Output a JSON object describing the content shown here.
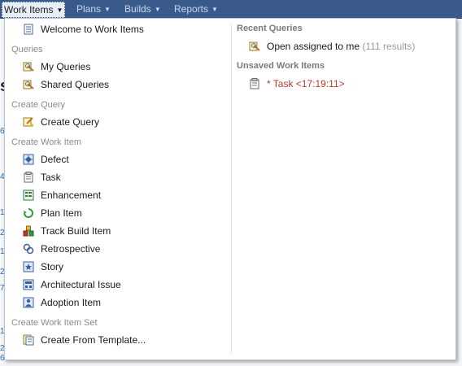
{
  "nav": {
    "items": [
      {
        "label": "Work Items"
      },
      {
        "label": "Plans"
      },
      {
        "label": "Builds"
      },
      {
        "label": "Reports"
      }
    ]
  },
  "menu": {
    "welcome": "Welcome to Work Items",
    "queries": {
      "header": "Queries",
      "my": "My Queries",
      "shared": "Shared Queries"
    },
    "create_query": {
      "header": "Create Query",
      "item": "Create Query"
    },
    "create_work_item": {
      "header": "Create Work Item",
      "items": [
        {
          "label": "Defect",
          "icon": "defect-icon"
        },
        {
          "label": "Task",
          "icon": "task-icon"
        },
        {
          "label": "Enhancement",
          "icon": "enhancement-icon"
        },
        {
          "label": "Plan Item",
          "icon": "plan-item-icon"
        },
        {
          "label": "Track Build Item",
          "icon": "track-build-icon"
        },
        {
          "label": "Retrospective",
          "icon": "retrospective-icon"
        },
        {
          "label": "Story",
          "icon": "story-icon"
        },
        {
          "label": "Architectural Issue",
          "icon": "architectural-issue-icon"
        },
        {
          "label": "Adoption Item",
          "icon": "adoption-item-icon"
        }
      ]
    },
    "create_set": {
      "header": "Create Work Item Set",
      "item": "Create From Template..."
    },
    "recent_queries": {
      "header": "Recent Queries",
      "label": "Open assigned to me",
      "count": "(111 results)"
    },
    "unsaved": {
      "header": "Unsaved Work Items",
      "label": "* Task <17:19:11>"
    }
  },
  "background": {
    "title": "s",
    "numbers": [
      "6",
      "4",
      "1",
      "2",
      "1",
      "2",
      "7",
      "1",
      "2",
      "6"
    ]
  },
  "colors": {
    "nav_bar": "#3b5a8c",
    "recent_unsaved_text": "#b83a2e"
  }
}
